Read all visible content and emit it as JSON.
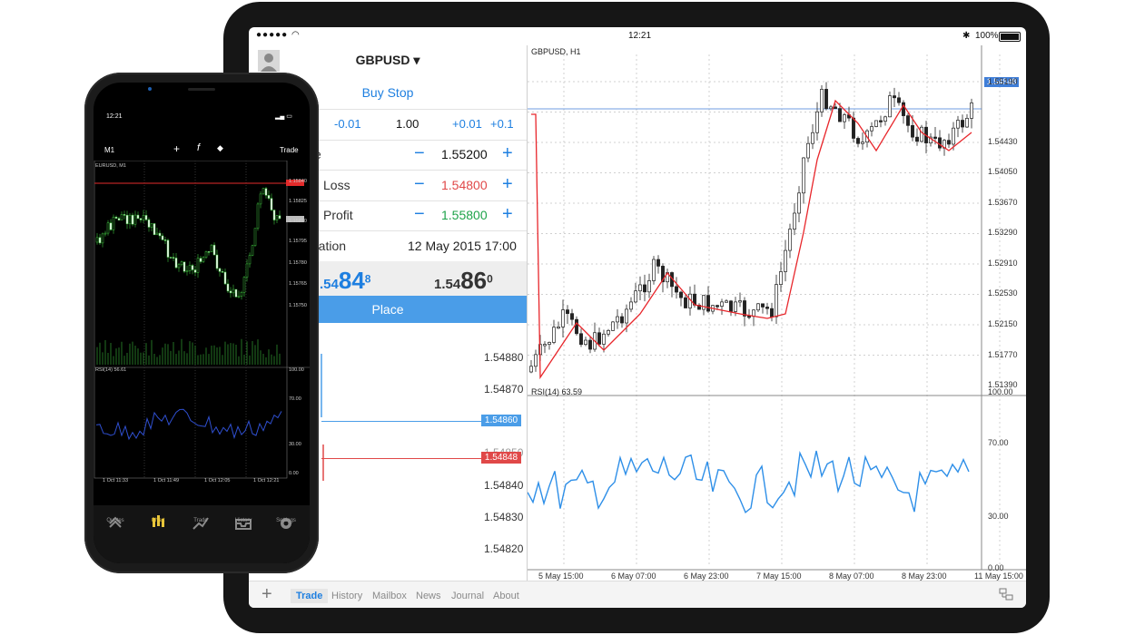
{
  "tablet": {
    "status": {
      "time": "12:21",
      "battery": "100%"
    },
    "order": {
      "symbol": "GBPUSD ▾",
      "type": "Buy Stop",
      "volume": {
        "minus_big": "-0.01",
        "value": "1.00",
        "plus_small": "+0.01",
        "plus_big": "+0.1"
      },
      "price_label": "e",
      "price_value": "1.55200",
      "stop_loss_label": "Loss",
      "stop_loss_value": "1.54800",
      "take_profit_label": "Profit",
      "take_profit_value": "1.55800",
      "expiration_label": "ration",
      "expiration_value": "12 May 2015 17:00",
      "bid_small": ".54",
      "bid_big": "84",
      "bid_sup": "8",
      "ask_small": "1.54",
      "ask_big": "86",
      "ask_sup": "0",
      "place_button": "Place"
    },
    "depth": {
      "prices": [
        "1.54880",
        "1.54870",
        "1.54840",
        "1.54830",
        "1.54820"
      ],
      "hidden_price": "1.54850",
      "tag_blue": "1.54860",
      "tag_red": "1.54848"
    },
    "chart": {
      "title": "GBPUSD, H1",
      "y_labels": [
        "1.55190",
        "1.54430",
        "1.54050",
        "1.53670",
        "1.53290",
        "1.52910",
        "1.52530",
        "1.52150",
        "1.51770",
        "1.51390"
      ],
      "price_tag": "1.54848",
      "rsi_label": "RSI(14) 63.59",
      "rsi_levels": [
        "100.00",
        "70.00",
        "30.00",
        "0.00"
      ],
      "x_labels": [
        "5 May 15:00",
        "6 May 07:00",
        "6 May 23:00",
        "7 May 15:00",
        "8 May 07:00",
        "8 May 23:00",
        "11 May 15:00"
      ]
    },
    "tabs": [
      "Trade",
      "History",
      "Mailbox",
      "News",
      "Journal",
      "About"
    ],
    "colors": {
      "blue": "#1e7fe0",
      "red": "#e04848",
      "green": "#1ea34a",
      "ma": "#e8262b",
      "rsi": "#2e8fe8"
    }
  },
  "phone": {
    "time": "12:21",
    "timeframe": "M1",
    "trade": "Trade",
    "chart_title": "EURUSD, M1",
    "y_labels": [
      "1.15840",
      "1.15825",
      "1.15810",
      "1.15795",
      "1.15780",
      "1.15765",
      "1.15750"
    ],
    "rsi_label": "RSI(14) 56.61",
    "rsi_levels": [
      "100.00",
      "70.00",
      "30.00",
      "0.00"
    ],
    "x_labels": [
      "1 Oct 11:33",
      "1 Oct 11:49",
      "1 Oct 12:05",
      "1 Oct 12:21"
    ],
    "nav": [
      {
        "label": "Quotes",
        "icon": "quotes-icon"
      },
      {
        "label": "Chart",
        "icon": "chart-icon"
      },
      {
        "label": "Trade",
        "icon": "trade-icon"
      },
      {
        "label": "History",
        "icon": "history-icon"
      },
      {
        "label": "Settings",
        "icon": "gear-icon"
      }
    ]
  }
}
